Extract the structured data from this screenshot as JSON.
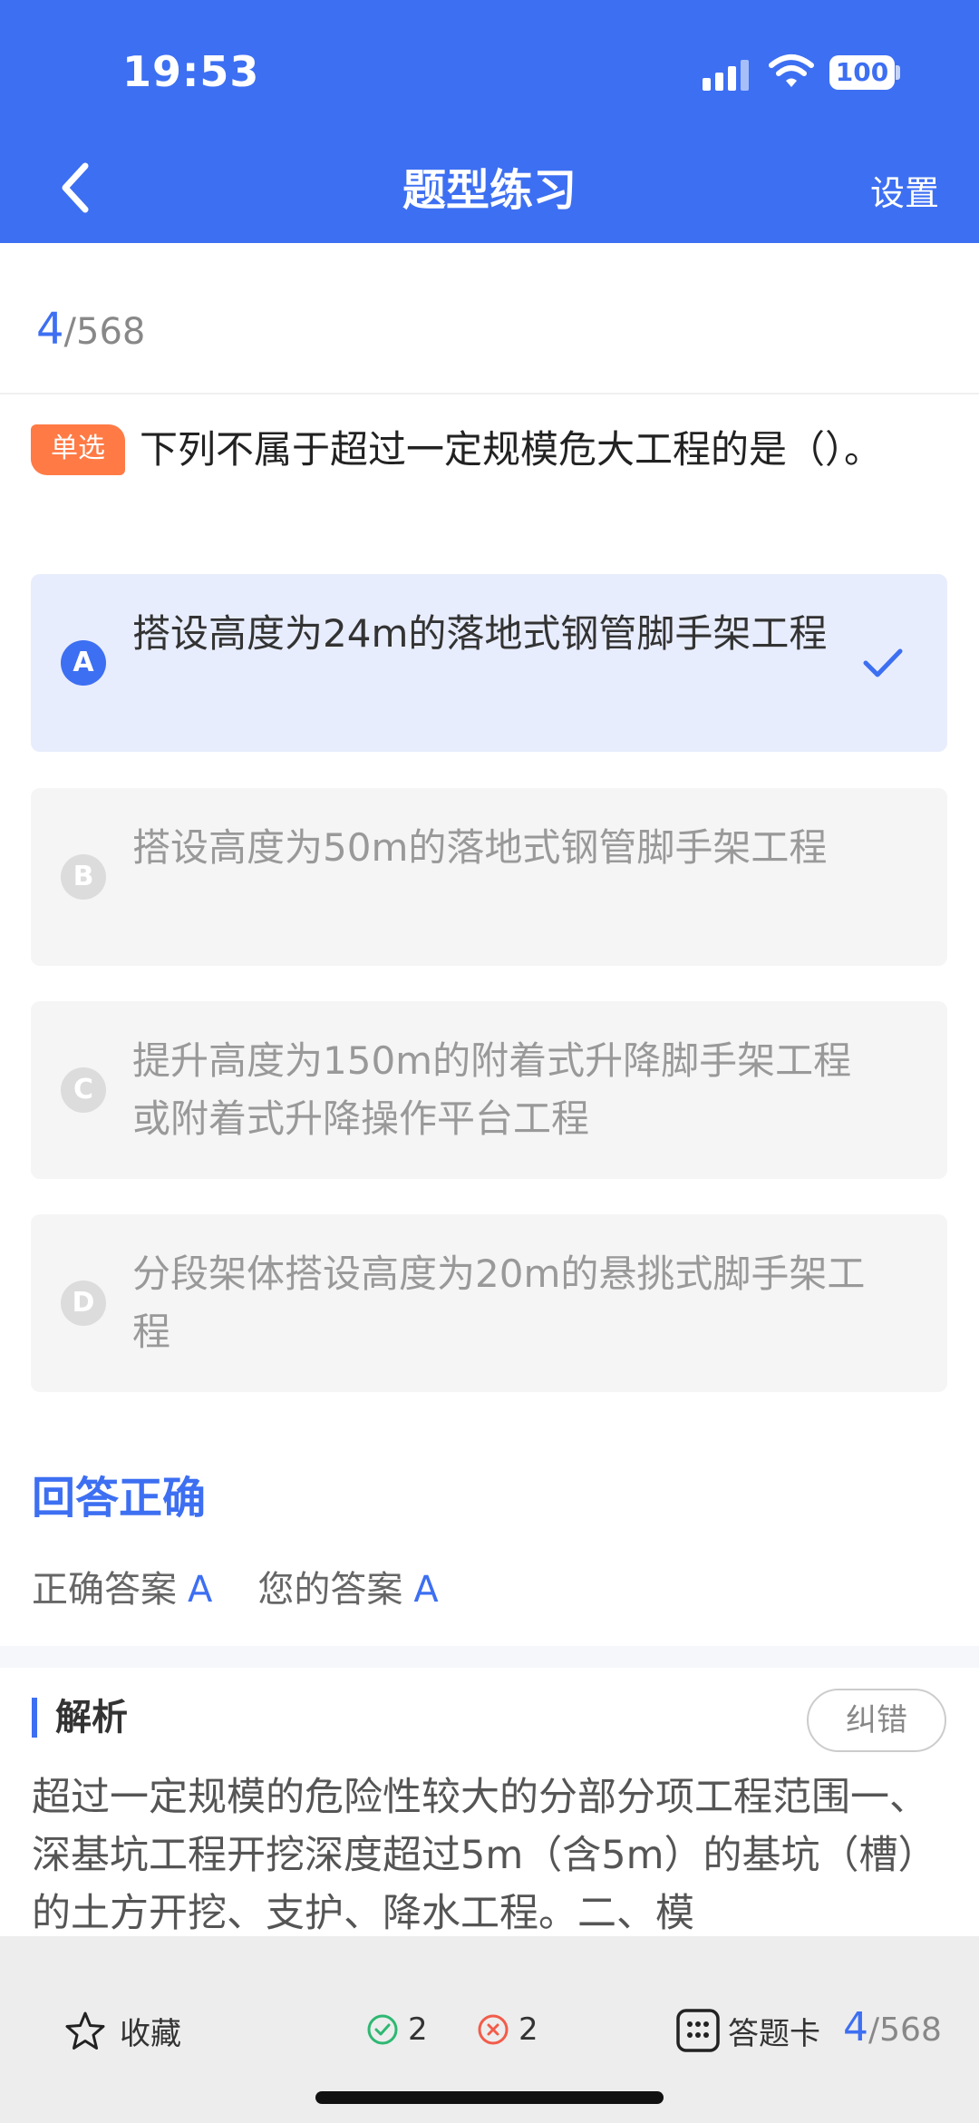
{
  "status_bar": {
    "time": "19:53",
    "battery": "100"
  },
  "header": {
    "title": "题型练习",
    "settings": "设置"
  },
  "progress": {
    "current": "4",
    "total": "/568"
  },
  "question": {
    "type_badge": "单选",
    "text": "下列不属于超过一定规模危大工程的是（）。"
  },
  "options": [
    {
      "letter": "A",
      "text": "搭设高度为24m的落地式钢管脚手架工程",
      "selected": true
    },
    {
      "letter": "B",
      "text": "搭设高度为50m的落地式钢管脚手架工程",
      "selected": false
    },
    {
      "letter": "C",
      "text": "提升高度为150m的附着式升降脚手架工程或附着式升降操作平台工程",
      "selected": false
    },
    {
      "letter": "D",
      "text": "分段架体搭设高度为20m的悬挑式脚手架工程",
      "selected": false
    }
  ],
  "result": {
    "title": "回答正确",
    "correct_label": "正确答案",
    "correct_value": "A",
    "yours_label": "您的答案",
    "yours_value": "A"
  },
  "analysis": {
    "heading": "解析",
    "report_button": "纠错",
    "text": "超过一定规模的危险性较大的分部分项工程范围一、深基坑工程开挖深度超过5m（含5m）的基坑（槽）的土方开挖、支护、降水工程。二、模"
  },
  "bottom_bar": {
    "favorite": "收藏",
    "correct_count": "2",
    "wrong_count": "2",
    "answer_card": "答题卡",
    "progress_current": "4",
    "progress_total": "/568"
  },
  "colors": {
    "primary": "#3d6ff2",
    "badge": "#ff7a45",
    "correct": "#2eb872",
    "wrong": "#f25c4a"
  }
}
